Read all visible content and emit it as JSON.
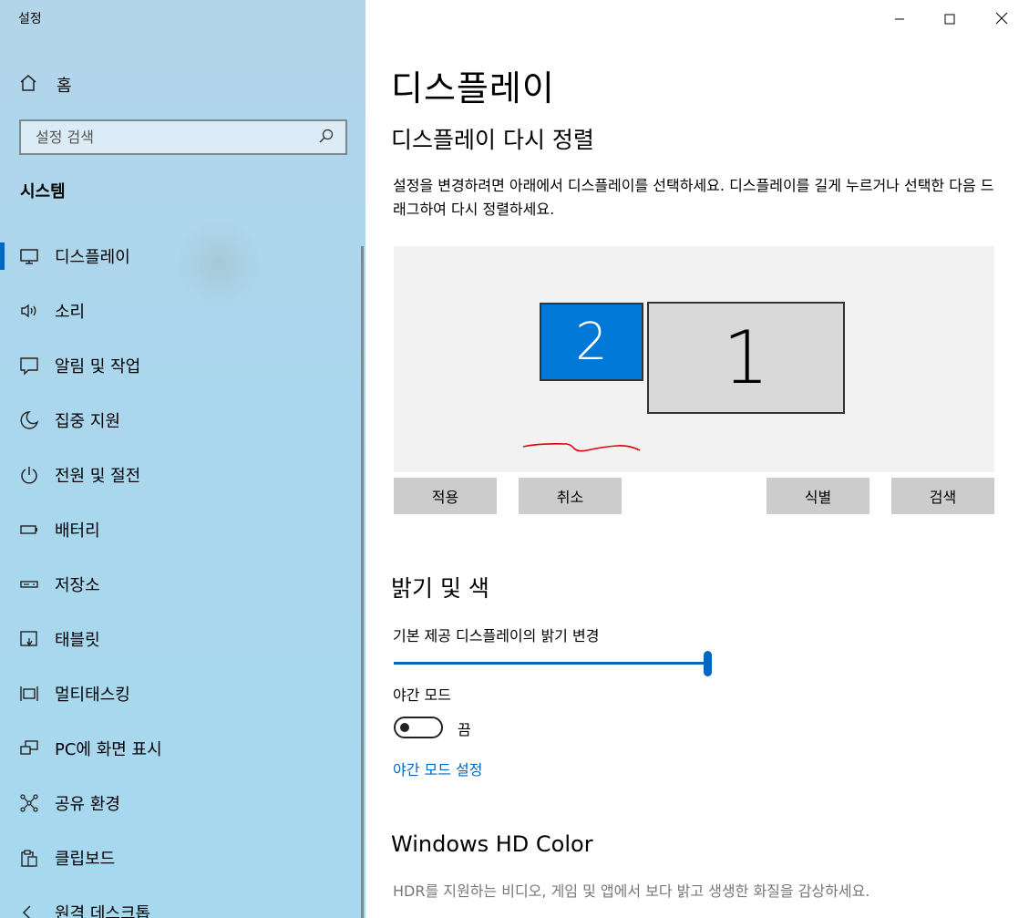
{
  "app_title": "설정",
  "sidebar": {
    "home_label": "홈",
    "search_placeholder": "설정 검색",
    "section_title": "시스템",
    "items": [
      {
        "label": "디스플레이",
        "icon": "monitor-icon",
        "selected": true
      },
      {
        "label": "소리",
        "icon": "speaker-icon"
      },
      {
        "label": "알림 및 작업",
        "icon": "notification-icon"
      },
      {
        "label": "집중 지원",
        "icon": "moon-icon"
      },
      {
        "label": "전원 및 절전",
        "icon": "power-icon"
      },
      {
        "label": "배터리",
        "icon": "battery-icon"
      },
      {
        "label": "저장소",
        "icon": "storage-icon"
      },
      {
        "label": "태블릿",
        "icon": "tablet-icon"
      },
      {
        "label": "멀티태스킹",
        "icon": "multitasking-icon"
      },
      {
        "label": "PC에 화면 표시",
        "icon": "project-icon"
      },
      {
        "label": "공유 환경",
        "icon": "share-icon"
      },
      {
        "label": "클립보드",
        "icon": "clipboard-icon"
      },
      {
        "label": "원격 데스크톱",
        "icon": "remote-desktop-icon"
      }
    ]
  },
  "window_controls": {
    "minimize": "minimize-icon",
    "maximize": "maximize-icon",
    "close": "close-icon"
  },
  "main": {
    "page_title": "디스플레이",
    "rearrange_title": "디스플레이 다시 정렬",
    "rearrange_desc": "설정을 변경하려면 아래에서 디스플레이를 선택하세요. 디스플레이를 길게 누르거나 선택한 다음 드래그하여 다시 정렬하세요.",
    "monitors": {
      "primary": "1",
      "secondary": "2"
    },
    "buttons": {
      "apply": "적용",
      "cancel": "취소",
      "identify": "식별",
      "detect": "검색"
    },
    "brightness_title": "밝기 및 색",
    "brightness_label": "기본 제공 디스플레이의 밝기 변경",
    "brightness_value": 100,
    "night_mode_label": "야간 모드",
    "night_mode_state": "끔",
    "night_mode_link": "야간 모드 설정",
    "hdr_title": "Windows HD Color",
    "hdr_desc": "HDR를 지원하는 비디오, 게임 및 앱에서 보다 밝고 생생한 화질을 감상하세요."
  },
  "colors": {
    "accent": "#0067c0",
    "monitor_selected": "#0078d7",
    "annotation": "#e00000"
  }
}
